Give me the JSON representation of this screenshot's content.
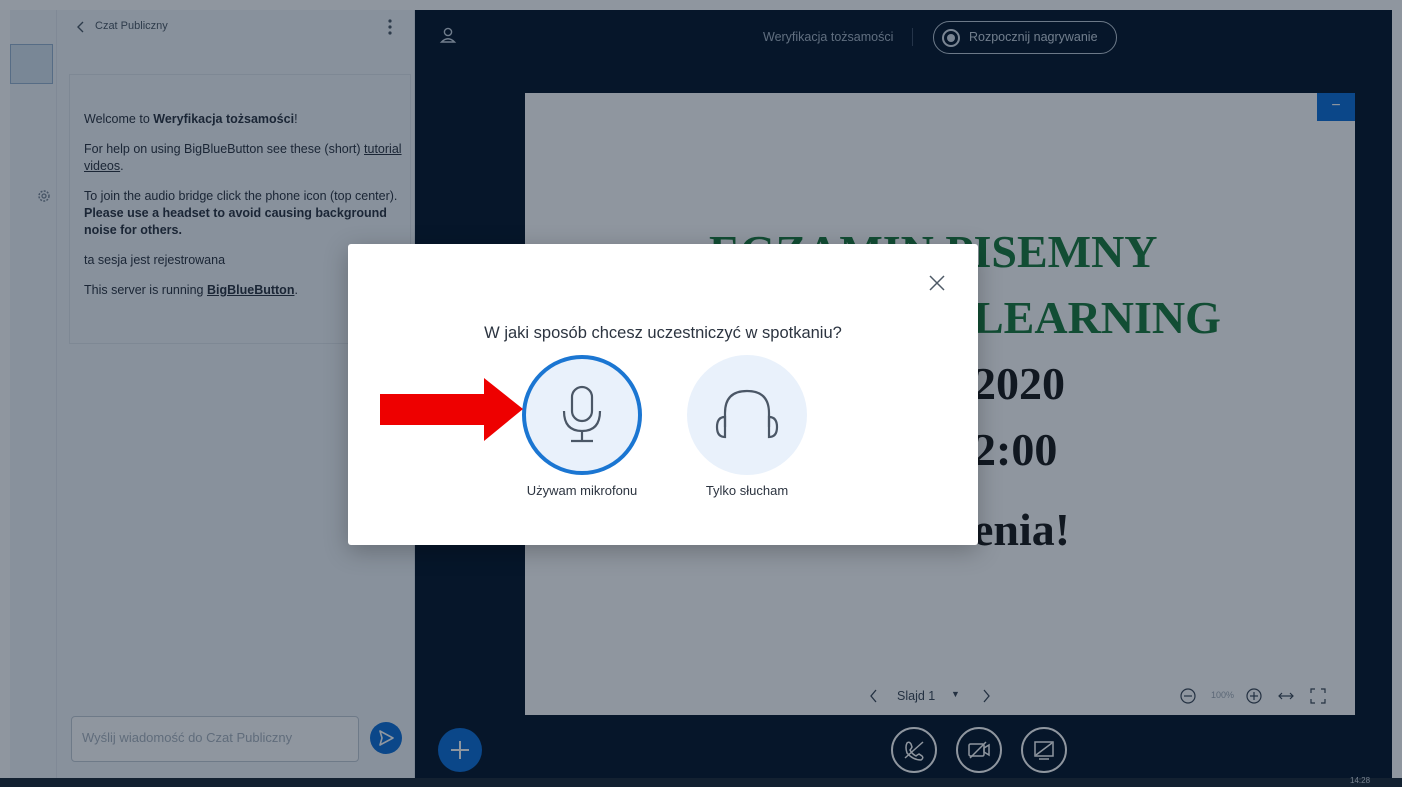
{
  "chat": {
    "title": "Czat Publiczny",
    "welcome": {
      "line1_prefix": "Welcome to ",
      "line1_bold": "Weryfikacja tożsamości",
      "line1_suffix": "!",
      "line2_text": "For help on using BigBlueButton see these (short) ",
      "line2_link": "tutorial videos",
      "line2_end": ".",
      "line3_text": "To join the audio bridge click the phone icon (top center). ",
      "line3_bold": "Please use a headset to avoid causing background noise for others.",
      "line4": "ta sesja jest rejestrowana",
      "line5_text": "This server is running ",
      "line5_link": "BigBlueButton",
      "line5_end": "."
    },
    "input_placeholder": "Wyślij wiadomość do Czat Publiczny"
  },
  "header": {
    "meeting_title": "Weryfikacja tożsamości",
    "record_label": "Rozpocznij nagrywanie"
  },
  "slide": {
    "lines": [
      {
        "text": "EGZAMIN PISEMNY",
        "color": "#1d7a3c"
      },
      {
        "text": "LEARNING",
        "color": "#1d7a3c"
      },
      {
        "text": "2020",
        "color": "#1a1a1a"
      },
      {
        "text": "2:00",
        "color": "#1a1a1a"
      },
      {
        "text": "enia!",
        "color": "#1a1a1a"
      }
    ],
    "toolbar": {
      "slide_label": "Slajd 1",
      "zoom": "100%"
    }
  },
  "modal": {
    "question": "W jaki sposób chcesz uczestniczyć w spotkaniu?",
    "option_mic": "Używam mikrofonu",
    "option_listen": "Tylko słucham"
  },
  "taskbar": {
    "clock": "14:28"
  },
  "colors": {
    "accent": "#0f70d7",
    "dark_bg": "#06172a",
    "arrow": "#ee0000"
  }
}
